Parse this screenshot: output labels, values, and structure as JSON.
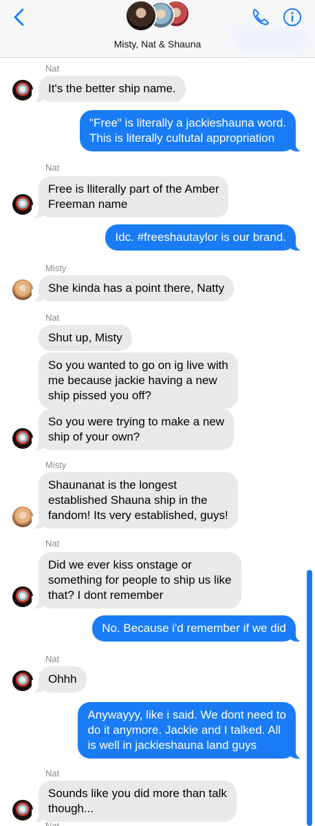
{
  "header": {
    "group_name": "Misty, Nat & Shauna",
    "back_icon": "chevron-left-icon",
    "phone_icon": "phone-icon",
    "info_icon": "info-icon",
    "accent_color": "#1a7cf4"
  },
  "messages": [
    {
      "sender": "Nat",
      "text": "It's the better ship name."
    },
    {
      "text": "\"Free\" is literally a jackieshauna word.\nThis is literally cultutal appropriation"
    },
    {
      "sender": "Nat",
      "text": "Free is lliterally part of the Amber\nFreeman name"
    },
    {
      "text": "Idc. #freeshautaylor is our brand."
    },
    {
      "sender": "Misty",
      "text": "She kinda has a point there, Natty"
    },
    {
      "sender": "Nat",
      "text": "Shut up, Misty"
    },
    {
      "text": "So you wanted to go on ig live with\nme because jackie having a new\nship pissed you off?"
    },
    {
      "text": "So you were trying to make a new\nship of your own?"
    },
    {
      "sender": "Misty",
      "text": "Shaunanat is the longest\nestablished Shauna ship in the\nfandom! Its very established, guys!"
    },
    {
      "sender": "Nat",
      "text": "Did we ever kiss onstage or\nsomething for people to ship us like\nthat? I dont remember"
    },
    {
      "text": "No. Because i'd remember if we did"
    },
    {
      "sender": "Nat",
      "text": "Ohhh"
    },
    {
      "text": "Anywayyy, like i said. We dont need to\ndo it anymore. Jackie and I talked. All\nis well in jackieshauna land guys"
    },
    {
      "sender": "Nat",
      "text": "Sounds like you did more than talk\nthough..."
    },
    {
      "sender": "Nat"
    }
  ]
}
